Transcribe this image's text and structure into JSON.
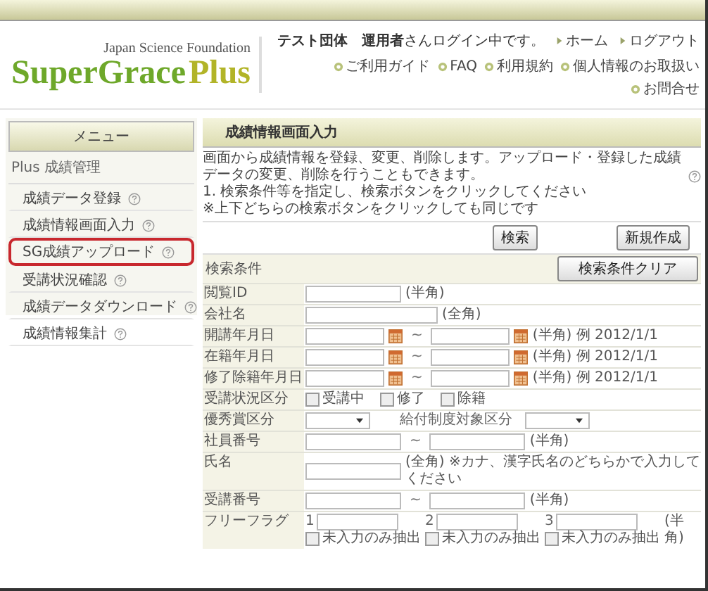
{
  "header": {
    "org": "Japan Science Foundation",
    "logo_main": "SuperGrace",
    "logo_accent": "Plus",
    "login_message": "**テスト団体**　**運用者**さんログイン中です。",
    "nav_links": [
      "ホーム",
      "ログアウト"
    ],
    "sub_links": [
      "ご利用ガイド",
      "FAQ",
      "利用規約",
      "個人情報のお取扱い",
      "お問合せ"
    ]
  },
  "sidebar": {
    "heading": "メニュー",
    "section": "Plus 成績管理",
    "items": [
      {
        "label": "成績データ登録",
        "highlighted": false
      },
      {
        "label": "成績情報画面入力",
        "highlighted": false
      },
      {
        "label": "SG成績アップロード",
        "highlighted": true
      },
      {
        "label": "受講状況確認",
        "highlighted": false
      },
      {
        "label": "成績データダウンロード",
        "highlighted": false
      },
      {
        "label": "成績情報集計",
        "highlighted": false
      }
    ]
  },
  "main": {
    "title": "成績情報画面入力",
    "description": "画面から成績情報を登録、変更、削除します。アップロード・登録した成績データの変更、削除を行うこともできます。",
    "instructions": [
      "1. 検索条件等を指定し、検索ボタンをクリックしてください",
      "※上下どちらの検索ボタンをクリックしても同じです"
    ],
    "search_button": "検索",
    "create_button": "新規作成",
    "conditions": {
      "heading": "検索条件",
      "clear_button": "検索条件クリア",
      "rows": [
        {
          "label": "閲覧ID",
          "items": [
            {
              "kind": "field"
            },
            {
              "kind": "note",
              "text": "(半角)"
            }
          ]
        },
        {
          "label": "会社名",
          "items": [
            {
              "kind": "widefield"
            },
            {
              "kind": "note",
              "text": "(全角)"
            }
          ]
        },
        {
          "label": "開講年月日",
          "items": [
            {
              "kind": "date"
            },
            {
              "kind": "tilde",
              "text": "~"
            },
            {
              "kind": "date"
            },
            {
              "kind": "note",
              "text": "(半角) 例 2012/1/1"
            }
          ]
        },
        {
          "label": "在籍年月日",
          "items": [
            {
              "kind": "date"
            },
            {
              "kind": "tilde",
              "text": "~"
            },
            {
              "kind": "date"
            },
            {
              "kind": "note",
              "text": "(半角) 例 2012/1/1"
            }
          ]
        },
        {
          "label": "修了除籍年月日",
          "items": [
            {
              "kind": "date"
            },
            {
              "kind": "tilde",
              "text": "~"
            },
            {
              "kind": "date"
            },
            {
              "kind": "note",
              "text": "(半角) 例 2012/1/1"
            }
          ]
        },
        {
          "label": "受講状況区分",
          "items": [
            {
              "kind": "checkbox",
              "label": "受講中",
              "checked": false
            },
            {
              "kind": "checkbox",
              "label": "修了",
              "checked": false
            },
            {
              "kind": "checkbox",
              "label": "除籍",
              "checked": false
            }
          ]
        },
        {
          "label": "優秀賞区分",
          "items": [
            {
              "kind": "select"
            },
            {
              "kind": "sublabel",
              "text": "給付制度対象区分"
            },
            {
              "kind": "select"
            }
          ]
        },
        {
          "label": "社員番号",
          "items": [
            {
              "kind": "field"
            },
            {
              "kind": "tilde",
              "text": "~"
            },
            {
              "kind": "field"
            },
            {
              "kind": "note",
              "text": "(半角)"
            }
          ]
        },
        {
          "label": "氏名",
          "items": [
            {
              "kind": "field"
            },
            {
              "kind": "note",
              "text": "(全角) ※カナ、漢字氏名のどちらかで入力してください"
            }
          ]
        },
        {
          "label": "受講番号",
          "items": [
            {
              "kind": "field"
            },
            {
              "kind": "tilde",
              "text": "~"
            },
            {
              "kind": "field"
            },
            {
              "kind": "note",
              "text": "(半角)"
            }
          ]
        },
        {
          "label": "フリーフラグ",
          "items": [
            {
              "kind": "flag",
              "number": "1",
              "checkbox_label": "未入力のみ抽出",
              "checked": false
            },
            {
              "kind": "flag",
              "number": "2",
              "checkbox_label": "未入力のみ抽出",
              "checked": false
            },
            {
              "kind": "flag",
              "number": "3",
              "checkbox_label": "未入力のみ抽出",
              "checked": false
            },
            {
              "kind": "note",
              "text": "(半角)"
            }
          ]
        }
      ]
    }
  }
}
